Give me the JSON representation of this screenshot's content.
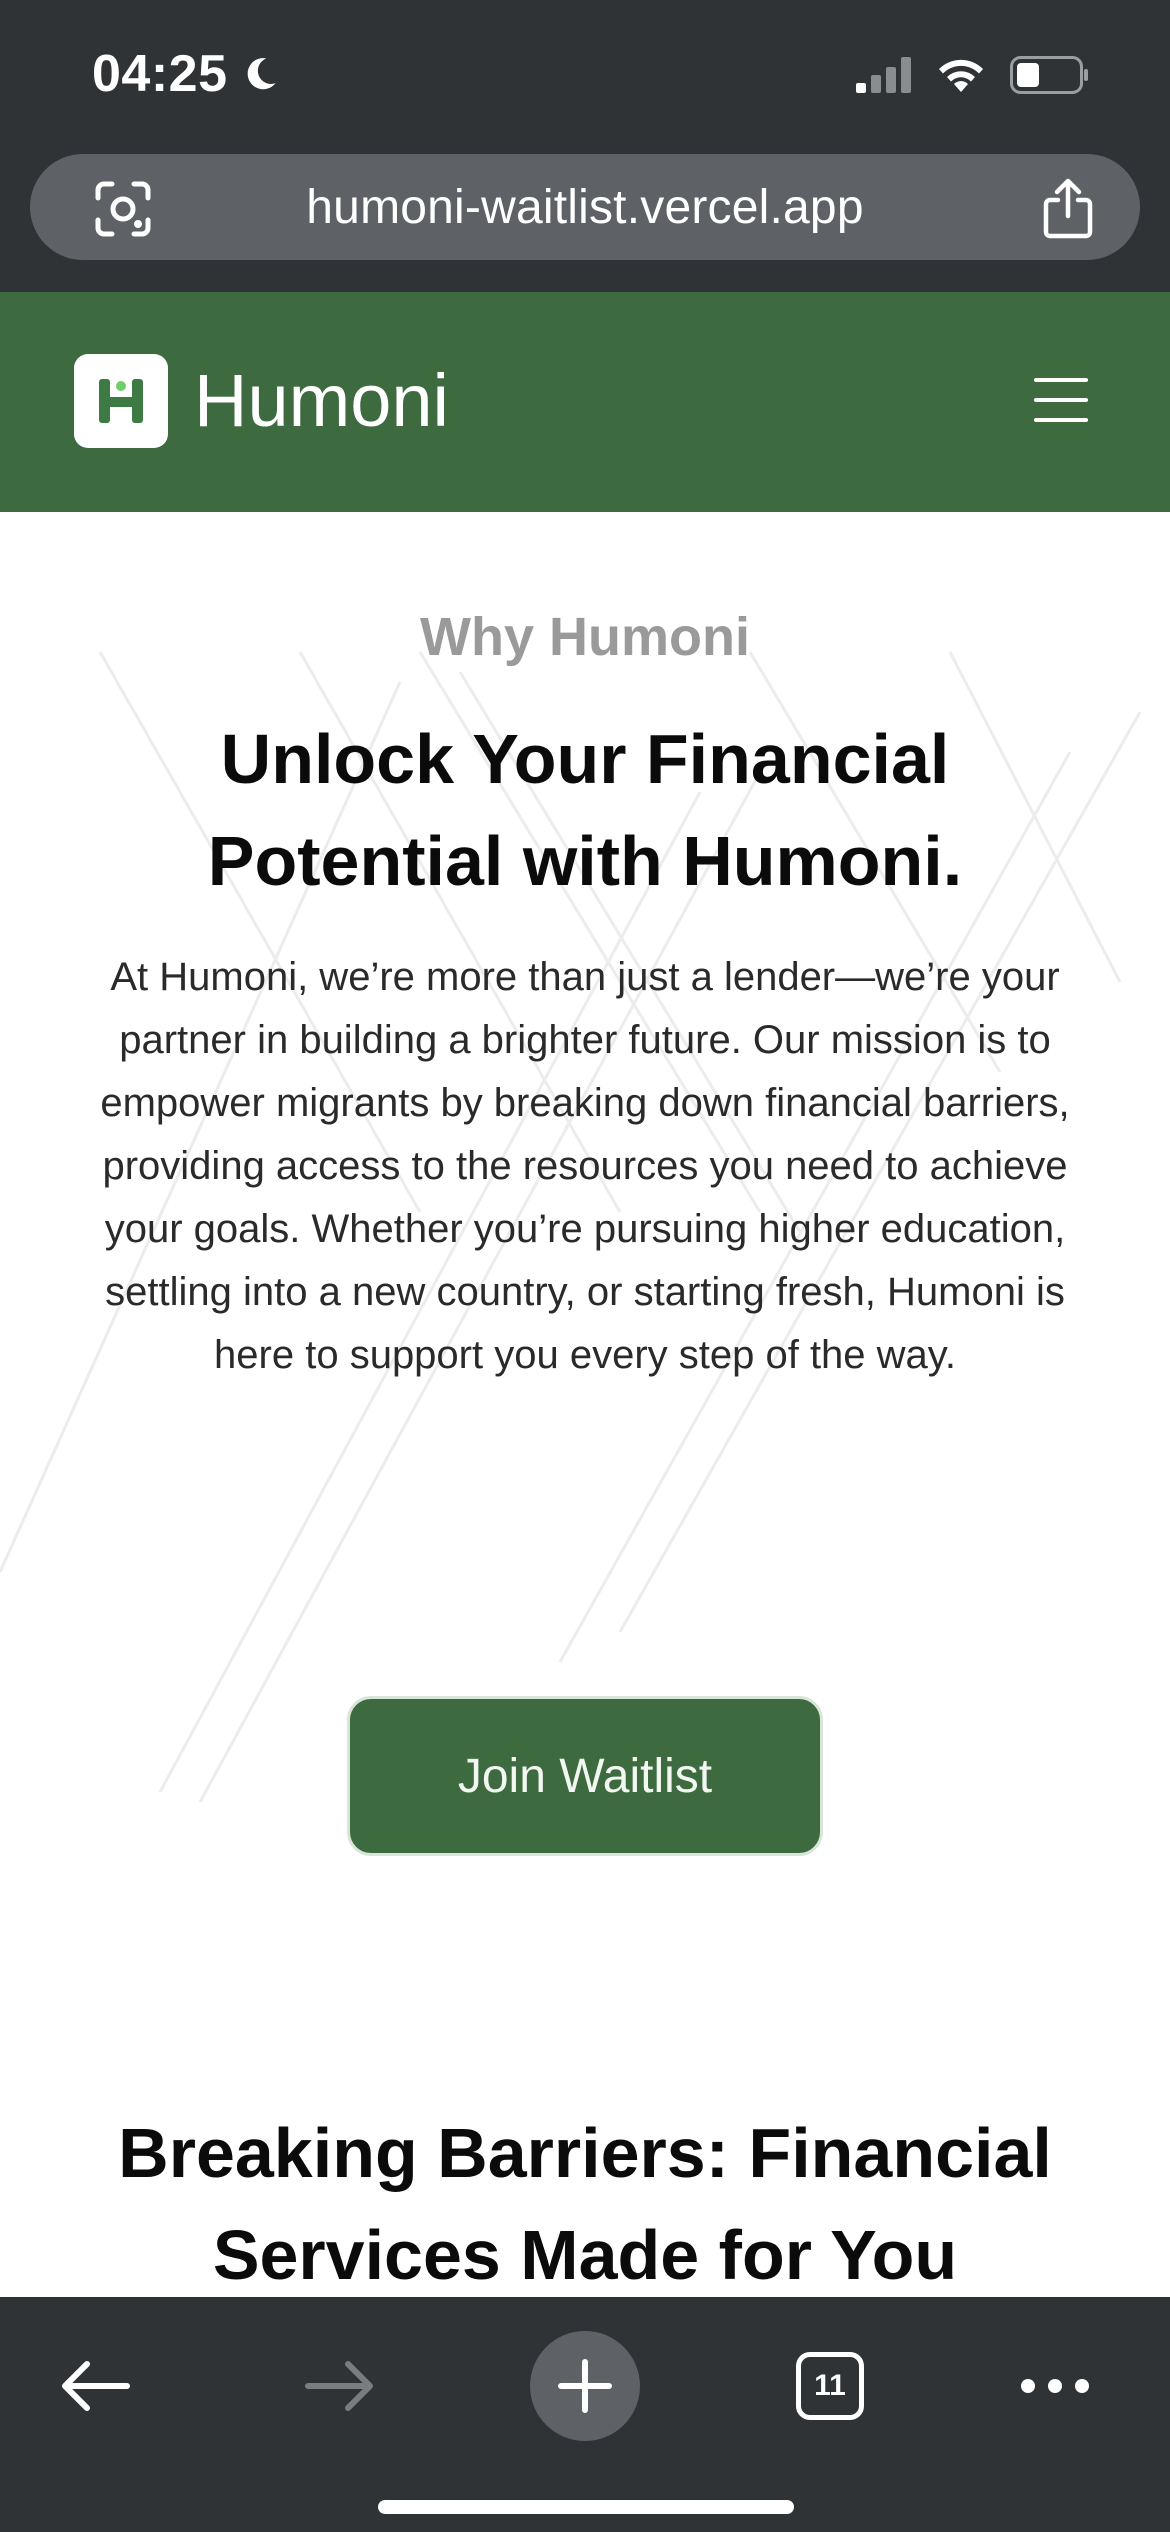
{
  "status_bar": {
    "time": "04:25",
    "moon_icon": "moon-icon",
    "signal_icon": "cellular-signal-icon",
    "wifi_icon": "wifi-icon",
    "battery_icon": "battery-icon"
  },
  "browser": {
    "url": "humoni-waitlist.vercel.app",
    "scan_icon": "visual-lookup-icon",
    "share_icon": "share-icon",
    "tab_count": "11",
    "toolbar_icons": [
      "back-arrow-icon",
      "forward-arrow-icon",
      "plus-icon",
      "tabs-icon",
      "more-icon"
    ]
  },
  "header": {
    "brand": "Humoni",
    "logo_letter": "H",
    "menu_icon": "hamburger-menu-icon"
  },
  "hero": {
    "eyebrow": "Why Humoni",
    "headline": "Unlock Your Financial Potential with Humoni.",
    "body": "At Humoni, we’re more than just a lender—we’re your partner in building a brighter future. Our mission is to empower migrants by breaking down financial barriers, providing access to the resources you need to achieve your goals. Whether you’re pursuing higher education, settling into a new country, or starting fresh, Humoni is here to support you every step of the way.",
    "cta_label": "Join Waitlist"
  },
  "next_section": {
    "title": "Breaking Barriers: Financial Services Made for You"
  },
  "colors": {
    "brand_green": "#3e6a40",
    "browser_chrome": "#303336",
    "url_pill": "#5e6165",
    "eyebrow_gray": "#9a9a9a"
  }
}
